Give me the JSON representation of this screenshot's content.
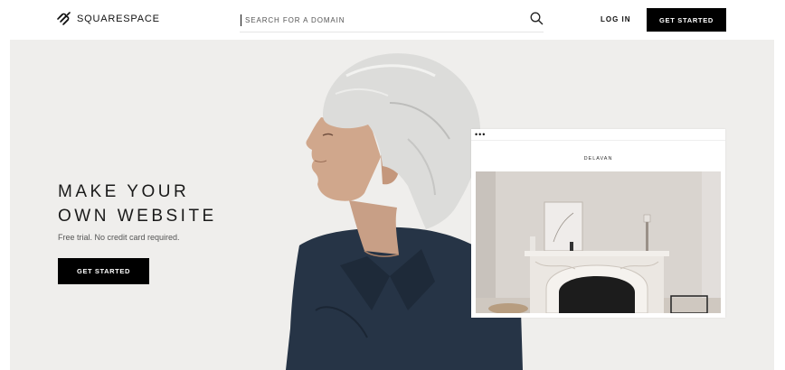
{
  "header": {
    "brand": "SQUARESPACE",
    "search_placeholder": "SEARCH FOR A DOMAIN",
    "login_label": "LOG IN",
    "cta_label": "GET STARTED"
  },
  "hero": {
    "headline_line1": "MAKE YOUR",
    "headline_line2": "OWN WEBSITE",
    "subtext": "Free trial. No credit card required.",
    "cta_label": "GET STARTED"
  },
  "preview": {
    "dots": "•••",
    "site_name": "DELAVAN"
  },
  "colors": {
    "hero_background": "#efeeec",
    "button": "#000000",
    "text": "#1a1a1a"
  },
  "icons": [
    "squarespace-logo-icon",
    "search-icon"
  ]
}
